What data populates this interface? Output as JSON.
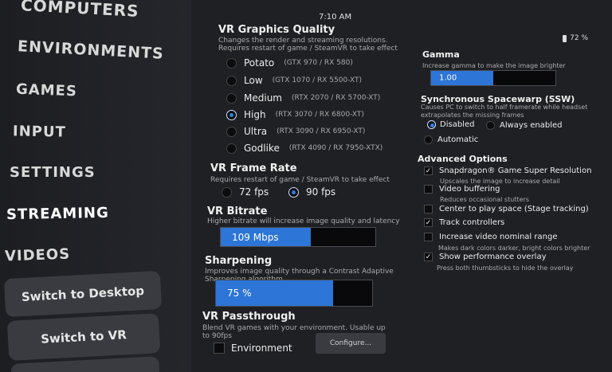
{
  "sidebar": {
    "items": [
      {
        "label": "COMPUTERS"
      },
      {
        "label": "ENVIRONMENTS"
      },
      {
        "label": "GAMES"
      },
      {
        "label": "INPUT"
      },
      {
        "label": "SETTINGS"
      },
      {
        "label": "STREAMING"
      },
      {
        "label": "VIDEOS"
      }
    ],
    "active": "STREAMING",
    "switch_desktop": "Switch to Desktop",
    "switch_vr": "Switch to VR"
  },
  "status": {
    "time": "7:10 AM",
    "battery": "72 %"
  },
  "graphics": {
    "title": "VR Graphics Quality",
    "desc1": "Changes the render and streaming resolutions.",
    "desc2": "Requires restart of game / SteamVR to take effect",
    "options": [
      {
        "label": "Potato",
        "gpu": "(GTX 970 / RX 580)",
        "checked": false
      },
      {
        "label": "Low",
        "gpu": "(GTX 1070 / RX 5500-XT)",
        "checked": false
      },
      {
        "label": "Medium",
        "gpu": "(RTX 2070 / RX 5700-XT)",
        "checked": false
      },
      {
        "label": "High",
        "gpu": "(RTX 3070 / RX 6800-XT)",
        "checked": true
      },
      {
        "label": "Ultra",
        "gpu": "(RTX 3090 / RX 6950-XT)",
        "checked": false
      },
      {
        "label": "Godlike",
        "gpu": "(RTX 4090 / RX 7950-XTX)",
        "checked": false
      }
    ]
  },
  "framerate": {
    "title": "VR Frame Rate",
    "desc": "Requires restart of game / SteamVR to take effect",
    "opt1": "72 fps",
    "opt2": "90 fps",
    "selected": "90 fps"
  },
  "bitrate": {
    "title": "VR Bitrate",
    "desc": "Higher bitrate will increase image quality and latency",
    "value": "109 Mbps",
    "fill_fraction": 0.58
  },
  "sharpening": {
    "title": "Sharpening",
    "desc1": "Improves image quality through a Contrast Adaptive",
    "desc2": "Sharpening algorithm",
    "value": "75 %",
    "fill_fraction": 0.75
  },
  "passthrough": {
    "title": "VR Passthrough",
    "desc1": "Blend VR games with your environment. Usable up",
    "desc2": "to 90fps",
    "env_label": "Environment",
    "configure": "Configure..."
  },
  "gamma": {
    "title": "Gamma",
    "desc": "Increase gamma to make the image brighter",
    "value": "1.00",
    "fill_fraction": 0.5
  },
  "ssw": {
    "title": "Synchronous Spacewarp (SSW)",
    "desc1": "Causes PC to switch to half framerate while headset",
    "desc2": "extrapolates the missing frames",
    "disabled": "Disabled",
    "always": "Always enabled",
    "automatic": "Automatic",
    "selected": "Disabled"
  },
  "advanced": {
    "title": "Advanced Options",
    "options": [
      {
        "label": "Snapdragon® Game Super Resolution",
        "desc": "Upscales the image to increase detail",
        "checked": true
      },
      {
        "label": "Video buffering",
        "desc": "Reduces occasional stutters",
        "checked": false
      },
      {
        "label": "Center to play space (Stage tracking)",
        "desc": "",
        "checked": false
      },
      {
        "label": "Track controllers",
        "desc": "",
        "checked": true
      },
      {
        "label": "Increase video nominal range",
        "desc": "Makes dark colors darker, bright colors brighter",
        "checked": false
      },
      {
        "label": "Show performance overlay",
        "desc": "Press both thumbsticks to hide the overlay",
        "checked": true
      }
    ]
  },
  "colors": {
    "accent": "#2d75d6",
    "panel": "#1f2024",
    "sidebar": "#1d1e22"
  }
}
